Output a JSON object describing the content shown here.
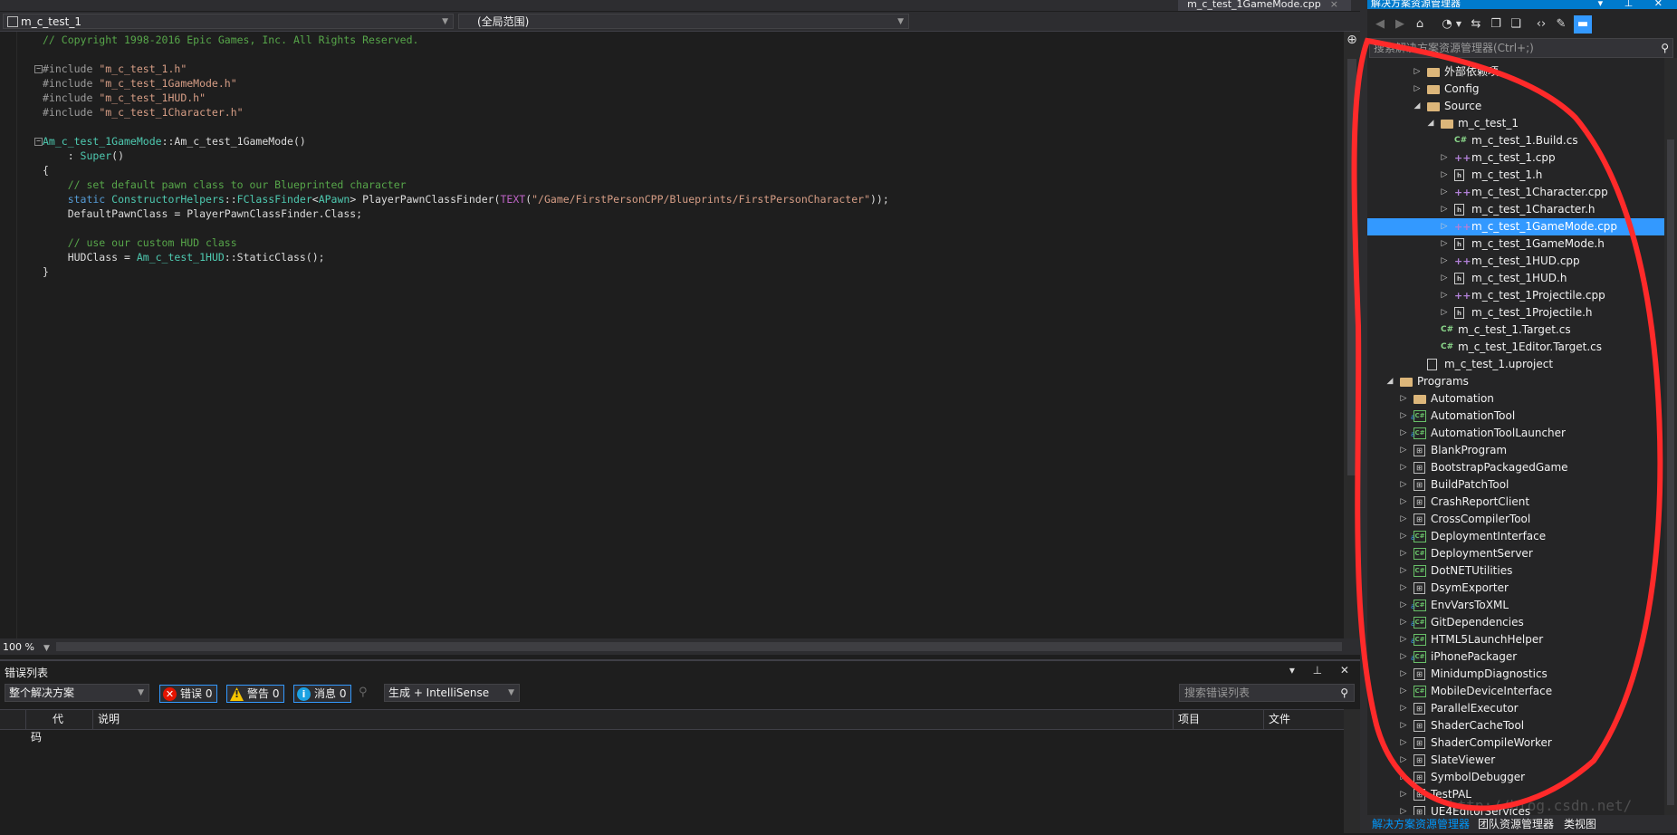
{
  "editor": {
    "file_tab": "m_c_test_1GameMode.cpp",
    "file_tab_close": "×",
    "nav_project": "m_c_test_1",
    "nav_scope": "(全局范围)",
    "zoom": "100 %",
    "code_lines": [
      [
        {
          "t": "// Copyright 1998-2016 Epic Games, Inc. All Rights Reserved.",
          "c": "comment"
        }
      ],
      [],
      [
        {
          "t": "#include ",
          "c": "pre"
        },
        {
          "t": "\"m_c_test_1.h\"",
          "c": "str"
        }
      ],
      [
        {
          "t": "#include ",
          "c": "pre"
        },
        {
          "t": "\"m_c_test_1GameMode.h\"",
          "c": "str"
        }
      ],
      [
        {
          "t": "#include ",
          "c": "pre"
        },
        {
          "t": "\"m_c_test_1HUD.h\"",
          "c": "str"
        }
      ],
      [
        {
          "t": "#include ",
          "c": "pre"
        },
        {
          "t": "\"m_c_test_1Character.h\"",
          "c": "str"
        }
      ],
      [],
      [
        {
          "t": "Am_c_test_1GameMode",
          "c": "type"
        },
        {
          "t": "::",
          "c": "txt"
        },
        {
          "t": "Am_c_test_1GameMode()",
          "c": "txt"
        }
      ],
      [
        {
          "t": "    : ",
          "c": "txt"
        },
        {
          "t": "Super",
          "c": "type"
        },
        {
          "t": "()",
          "c": "txt"
        }
      ],
      [
        {
          "t": "{",
          "c": "txt"
        }
      ],
      [
        {
          "t": "    // set default pawn class to our Blueprinted character",
          "c": "comment"
        }
      ],
      [
        {
          "t": "    static ",
          "c": "kw"
        },
        {
          "t": "ConstructorHelpers",
          "c": "type"
        },
        {
          "t": "::",
          "c": "txt"
        },
        {
          "t": "FClassFinder",
          "c": "type"
        },
        {
          "t": "<",
          "c": "txt"
        },
        {
          "t": "APawn",
          "c": "type"
        },
        {
          "t": "> PlayerPawnClassFinder(",
          "c": "txt"
        },
        {
          "t": "TEXT",
          "c": "mac"
        },
        {
          "t": "(",
          "c": "txt"
        },
        {
          "t": "\"/Game/FirstPersonCPP/Blueprints/FirstPersonCharacter\"",
          "c": "str"
        },
        {
          "t": "));",
          "c": "txt"
        }
      ],
      [
        {
          "t": "    DefaultPawnClass = PlayerPawnClassFinder.Class;",
          "c": "txt"
        }
      ],
      [],
      [
        {
          "t": "    // use our custom HUD class",
          "c": "comment"
        }
      ],
      [
        {
          "t": "    HUDClass = ",
          "c": "txt"
        },
        {
          "t": "Am_c_test_1HUD",
          "c": "type"
        },
        {
          "t": "::StaticClass();",
          "c": "txt"
        }
      ],
      [
        {
          "t": "}",
          "c": "txt"
        }
      ]
    ]
  },
  "error_list": {
    "title": "错误列表",
    "title_icons": "▾ ⊥ ✕",
    "scope": "整个解决方案",
    "errors_label": "错误 0",
    "warnings_label": "警告 0",
    "messages_label": "消息 0",
    "build_filter": "生成 + IntelliSense",
    "search_placeholder": "搜索错误列表",
    "columns": {
      "code": "代码",
      "desc": "说明",
      "project": "项目",
      "file": "文件"
    }
  },
  "solution_explorer": {
    "title": "解决方案资源管理器",
    "title_icons": "▾ ⊥ ✕",
    "search_placeholder": "搜索解决方案资源管理器(Ctrl+;)",
    "bottom_tabs": [
      "解决方案资源管理器",
      "团队资源管理器",
      "类视图"
    ],
    "tree": [
      {
        "label": "外部依赖项",
        "depth": 2,
        "exp": "▷",
        "icon": "folder"
      },
      {
        "label": "Config",
        "depth": 2,
        "exp": "▷",
        "icon": "folder"
      },
      {
        "label": "Source",
        "depth": 2,
        "exp": "◢",
        "icon": "folder"
      },
      {
        "label": "m_c_test_1",
        "depth": 3,
        "exp": "◢",
        "icon": "folder"
      },
      {
        "label": "m_c_test_1.Build.cs",
        "depth": 4,
        "exp": "",
        "icon": "cs"
      },
      {
        "label": "m_c_test_1.cpp",
        "depth": 4,
        "exp": "▷",
        "icon": "cpp"
      },
      {
        "label": "m_c_test_1.h",
        "depth": 4,
        "exp": "▷",
        "icon": "h"
      },
      {
        "label": "m_c_test_1Character.cpp",
        "depth": 4,
        "exp": "▷",
        "icon": "cpp"
      },
      {
        "label": "m_c_test_1Character.h",
        "depth": 4,
        "exp": "▷",
        "icon": "h"
      },
      {
        "label": "m_c_test_1GameMode.cpp",
        "depth": 4,
        "exp": "▷",
        "icon": "cpp",
        "selected": true
      },
      {
        "label": "m_c_test_1GameMode.h",
        "depth": 4,
        "exp": "▷",
        "icon": "h"
      },
      {
        "label": "m_c_test_1HUD.cpp",
        "depth": 4,
        "exp": "▷",
        "icon": "cpp"
      },
      {
        "label": "m_c_test_1HUD.h",
        "depth": 4,
        "exp": "▷",
        "icon": "h"
      },
      {
        "label": "m_c_test_1Projectile.cpp",
        "depth": 4,
        "exp": "▷",
        "icon": "cpp"
      },
      {
        "label": "m_c_test_1Projectile.h",
        "depth": 4,
        "exp": "▷",
        "icon": "h"
      },
      {
        "label": "m_c_test_1.Target.cs",
        "depth": 3,
        "exp": "",
        "icon": "cs"
      },
      {
        "label": "m_c_test_1Editor.Target.cs",
        "depth": 3,
        "exp": "",
        "icon": "cs"
      },
      {
        "label": "m_c_test_1.uproject",
        "depth": 2,
        "exp": "",
        "icon": "up"
      },
      {
        "label": "Programs",
        "depth": 0,
        "exp": "◢",
        "icon": "folder"
      },
      {
        "label": "Automation",
        "depth": 1,
        "exp": "▷",
        "icon": "folder"
      },
      {
        "label": "AutomationTool",
        "depth": 1,
        "exp": "▷",
        "icon": "csproj",
        "lock": true
      },
      {
        "label": "AutomationToolLauncher",
        "depth": 1,
        "exp": "▷",
        "icon": "csproj",
        "lock": true
      },
      {
        "label": "BlankProgram",
        "depth": 1,
        "exp": "▷",
        "icon": "proj"
      },
      {
        "label": "BootstrapPackagedGame",
        "depth": 1,
        "exp": "▷",
        "icon": "proj"
      },
      {
        "label": "BuildPatchTool",
        "depth": 1,
        "exp": "▷",
        "icon": "proj"
      },
      {
        "label": "CrashReportClient",
        "depth": 1,
        "exp": "▷",
        "icon": "proj"
      },
      {
        "label": "CrossCompilerTool",
        "depth": 1,
        "exp": "▷",
        "icon": "proj"
      },
      {
        "label": "DeploymentInterface",
        "depth": 1,
        "exp": "▷",
        "icon": "csproj",
        "lock": true
      },
      {
        "label": "DeploymentServer",
        "depth": 1,
        "exp": "▷",
        "icon": "csproj"
      },
      {
        "label": "DotNETUtilities",
        "depth": 1,
        "exp": "▷",
        "icon": "csproj"
      },
      {
        "label": "DsymExporter",
        "depth": 1,
        "exp": "▷",
        "icon": "proj"
      },
      {
        "label": "EnvVarsToXML",
        "depth": 1,
        "exp": "▷",
        "icon": "csproj",
        "lock": true
      },
      {
        "label": "GitDependencies",
        "depth": 1,
        "exp": "▷",
        "icon": "csproj",
        "lock": true
      },
      {
        "label": "HTML5LaunchHelper",
        "depth": 1,
        "exp": "▷",
        "icon": "csproj",
        "lock": true
      },
      {
        "label": "iPhonePackager",
        "depth": 1,
        "exp": "▷",
        "icon": "csproj",
        "lock": true
      },
      {
        "label": "MinidumpDiagnostics",
        "depth": 1,
        "exp": "▷",
        "icon": "proj"
      },
      {
        "label": "MobileDeviceInterface",
        "depth": 1,
        "exp": "▷",
        "icon": "csproj"
      },
      {
        "label": "ParallelExecutor",
        "depth": 1,
        "exp": "▷",
        "icon": "proj"
      },
      {
        "label": "ShaderCacheTool",
        "depth": 1,
        "exp": "▷",
        "icon": "proj"
      },
      {
        "label": "ShaderCompileWorker",
        "depth": 1,
        "exp": "▷",
        "icon": "proj"
      },
      {
        "label": "SlateViewer",
        "depth": 1,
        "exp": "▷",
        "icon": "proj"
      },
      {
        "label": "SymbolDebugger",
        "depth": 1,
        "exp": "▷",
        "icon": "proj"
      },
      {
        "label": "TestPAL",
        "depth": 1,
        "exp": "▷",
        "icon": "proj"
      },
      {
        "label": "UE4EditorServices",
        "depth": 1,
        "exp": "▷",
        "icon": "proj"
      }
    ]
  },
  "watermark": "http://blog.csdn.net/",
  "colors": {
    "accent": "#3399ff",
    "title_bar": "#007acc",
    "annotation": "#ff2a2a"
  }
}
